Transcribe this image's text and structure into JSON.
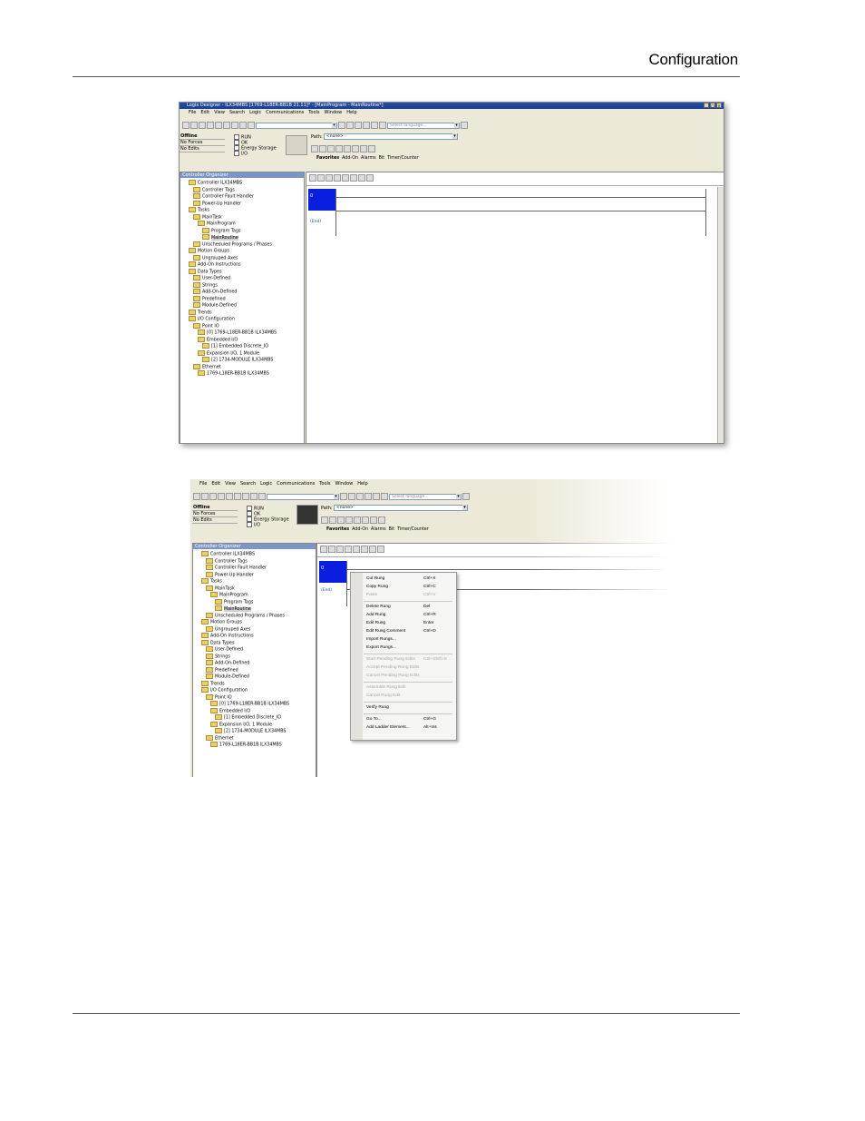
{
  "header": {
    "title": "Configuration"
  },
  "shot1": {
    "title": "Logix Designer - ILX34MBS [1769-L18ER-BB1B 21.11]* - [MainProgram - MainRoutine*]",
    "menu": [
      "File",
      "Edit",
      "View",
      "Search",
      "Logic",
      "Communications",
      "Tools",
      "Window",
      "Help"
    ],
    "language_placeholder": "Select language...",
    "status": {
      "offline": "Offline",
      "forces": "No Forces",
      "edits": "No Edits"
    },
    "checks": [
      "RUN",
      "OK",
      "Energy Storage",
      "I/O"
    ],
    "path_label": "Path:",
    "path_value": "<none>",
    "tabs": [
      "Favorites",
      "Add-On",
      "Alarms",
      "Bit",
      "Timer/Counter"
    ],
    "organizer_title": "Controller Organizer",
    "tree": [
      "Controller ILX34MBS",
      "Controller Tags",
      "Controller Fault Handler",
      "Power-Up Handler",
      "Tasks",
      "MainTask",
      "MainProgram",
      "Program Tags",
      "MainRoutine",
      "Unscheduled Programs / Phases",
      "Motion Groups",
      "Ungrouped Axes",
      "Add-On Instructions",
      "Data Types",
      "User-Defined",
      "Strings",
      "Add-On-Defined",
      "Predefined",
      "Module-Defined",
      "Trends",
      "I/O Configuration",
      "Point IO",
      "[0] 1769-L18ER-BB1B ILX34MBS",
      "Embedded I/O",
      "[1] Embedded Discrete_IO",
      "Expansion I/O, 1 Module",
      "[2] 1734-MODULE ILX34MBS",
      "Ethernet",
      "1769-L18ER-BB1B ILX34MBS"
    ],
    "rung_number": "0",
    "end_label": "(End)"
  },
  "shot2": {
    "menu": [
      "File",
      "Edit",
      "View",
      "Search",
      "Logic",
      "Communications",
      "Tools",
      "Window",
      "Help"
    ],
    "language_placeholder": "Select language...",
    "status": {
      "offline": "Offline",
      "forces": "No Forces",
      "edits": "No Edits"
    },
    "checks": [
      "RUN",
      "OK",
      "Energy Storage",
      "I/O"
    ],
    "path_label": "Path:",
    "path_value": "<none>",
    "tabs": [
      "Favorites",
      "Add-On",
      "Alarms",
      "Bit",
      "Timer/Counter"
    ],
    "organizer_title": "Controller Organizer",
    "rung_number": "0",
    "end_label": "(End)",
    "context_menu": [
      {
        "label": "Cut Rung",
        "shortcut": "Ctrl+X",
        "disabled": false
      },
      {
        "label": "Copy Rung",
        "shortcut": "Ctrl+C",
        "disabled": false
      },
      {
        "label": "Paste",
        "shortcut": "Ctrl+V",
        "disabled": true
      },
      {
        "label": "Delete Rung",
        "shortcut": "Del",
        "disabled": false
      },
      {
        "label": "Add Rung",
        "shortcut": "Ctrl+R",
        "disabled": false
      },
      {
        "label": "Edit Rung",
        "shortcut": "Enter",
        "disabled": false
      },
      {
        "label": "Edit Rung Comment",
        "shortcut": "Ctrl+D",
        "disabled": false
      },
      {
        "label": "Import Rungs...",
        "shortcut": "",
        "disabled": false
      },
      {
        "label": "Export Rungs...",
        "shortcut": "",
        "disabled": false
      },
      {
        "label": "Start Pending Rung Edits",
        "shortcut": "Ctrl+Shift+S",
        "disabled": true
      },
      {
        "label": "Accept Pending Rung Edits",
        "shortcut": "",
        "disabled": true
      },
      {
        "label": "Cancel Pending Rung Edits",
        "shortcut": "",
        "disabled": true
      },
      {
        "label": "Assemble Rung Edit",
        "shortcut": "",
        "disabled": true
      },
      {
        "label": "Cancel Rung Edit",
        "shortcut": "",
        "disabled": true
      },
      {
        "label": "Verify Rung",
        "shortcut": "",
        "disabled": false
      },
      {
        "label": "Go To...",
        "shortcut": "Ctrl+G",
        "disabled": false
      },
      {
        "label": "Add Ladder Element...",
        "shortcut": "Alt+Ins",
        "disabled": false
      }
    ]
  }
}
